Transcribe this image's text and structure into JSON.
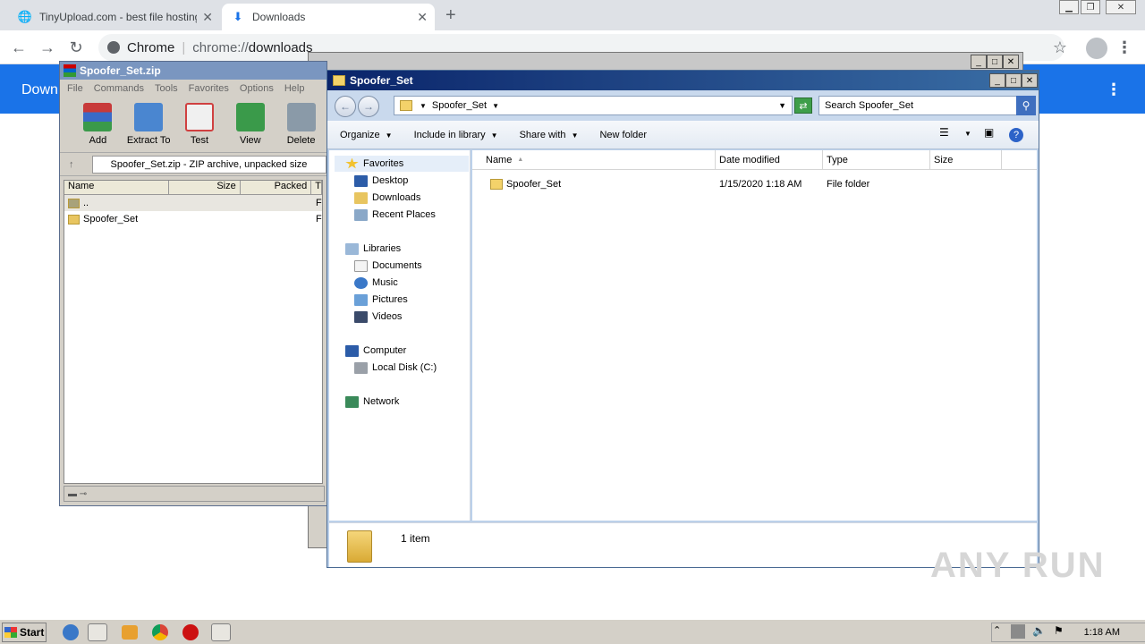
{
  "chrome": {
    "tabs": [
      {
        "title": "TinyUpload.com - best file hosting sc",
        "icon": "globe-icon",
        "active": false
      },
      {
        "title": "Downloads",
        "icon": "download-icon",
        "active": true
      }
    ],
    "new_tab": "+",
    "omnibox": {
      "site_label": "Chrome",
      "url_scheme": "chrome://",
      "url_path": "downloads"
    },
    "page_title": "Down"
  },
  "winrar": {
    "title": "Spoofer_Set.zip",
    "menu": [
      "File",
      "Commands",
      "Tools",
      "Favorites",
      "Options",
      "Help"
    ],
    "tools": [
      {
        "label": "Add",
        "color": "#c83a3a"
      },
      {
        "label": "Extract To",
        "color": "#4a86d0"
      },
      {
        "label": "Test",
        "color": "#d04040"
      },
      {
        "label": "View",
        "color": "#3a9a4a"
      },
      {
        "label": "Delete",
        "color": "#8a9aa8"
      }
    ],
    "address": "Spoofer_Set.zip - ZIP archive, unpacked size",
    "columns": [
      "Name",
      "Size",
      "Packed",
      "T"
    ],
    "rows": [
      {
        "name": "..",
        "type": "F"
      },
      {
        "name": "Spoofer_Set",
        "type": "F"
      }
    ]
  },
  "explorer": {
    "title": "Spoofer_Set",
    "path": "Spoofer_Set",
    "search_placeholder": "Search Spoofer_Set",
    "commands": [
      "Organize",
      "Include in library",
      "Share with",
      "New folder"
    ],
    "nav": {
      "favorites_header": "Favorites",
      "favorites": [
        "Desktop",
        "Downloads",
        "Recent Places"
      ],
      "libraries_header": "Libraries",
      "libraries": [
        "Documents",
        "Music",
        "Pictures",
        "Videos"
      ],
      "computer_header": "Computer",
      "computer": [
        "Local Disk (C:)"
      ],
      "network_header": "Network"
    },
    "columns": [
      "Name",
      "Date modified",
      "Type",
      "Size"
    ],
    "files": [
      {
        "name": "Spoofer_Set",
        "date": "1/15/2020 1:18 AM",
        "type": "File folder",
        "size": ""
      }
    ],
    "item_count": "1 item"
  },
  "watermark": "ANY RUN",
  "taskbar": {
    "start_label": "Start",
    "clock": "1:18 AM"
  }
}
